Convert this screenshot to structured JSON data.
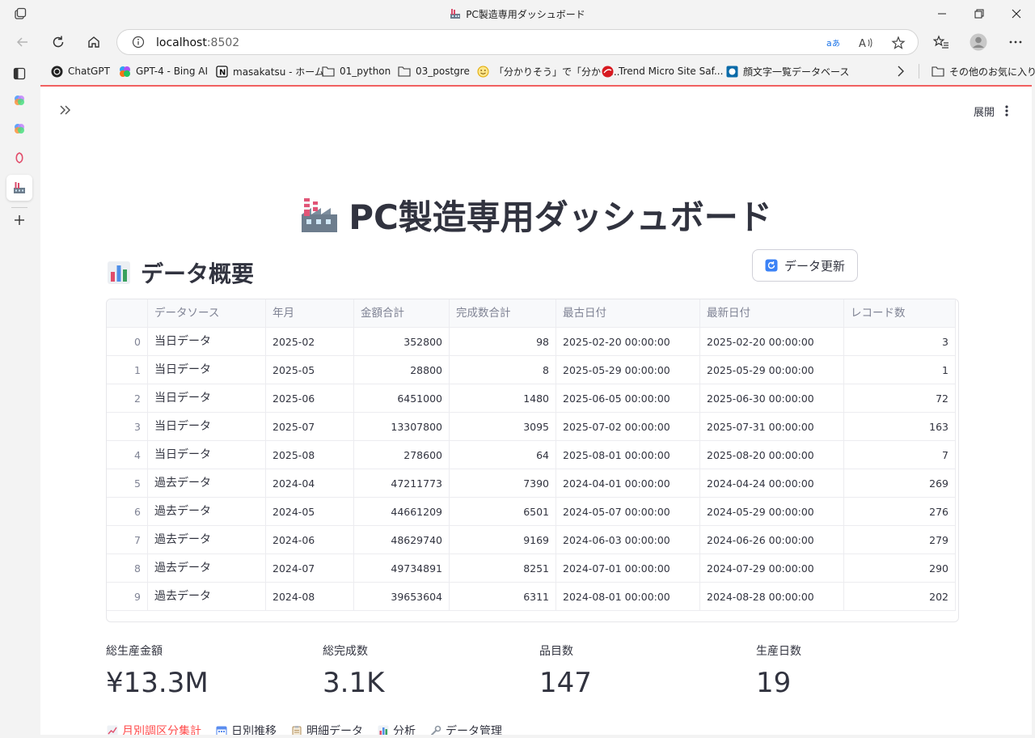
{
  "window": {
    "title": "PC製造専用ダッシュボード"
  },
  "address_bar": {
    "url_host": "localhost",
    "url_port": ":8502"
  },
  "bookmarks": [
    {
      "label": "ChatGPT",
      "icon": "openai-icon"
    },
    {
      "label": "GPT-4 - Bing AI",
      "icon": "copilot-icon"
    },
    {
      "label": "masakatsu - ホーム",
      "icon": "notion-icon"
    },
    {
      "label": "01_python",
      "icon": "folder-icon"
    },
    {
      "label": "03_postgre",
      "icon": "folder-icon"
    },
    {
      "label": "「分かりそう」で「分から...",
      "icon": "smile-icon"
    },
    {
      "label": "Trend Micro Site Saf...",
      "icon": "trendmicro-icon"
    },
    {
      "label": "顔文字一覧データベース",
      "icon": "site-icon"
    }
  ],
  "other_favorites": "その他のお気に入り",
  "app": {
    "deploy_label": "展開",
    "page_title": "PC製造専用ダッシュボード",
    "section_title": "データ概要",
    "refresh_button": "データ更新"
  },
  "table": {
    "columns": [
      "",
      "データソース",
      "年月",
      "金額合計",
      "完成数合計",
      "最古日付",
      "最新日付",
      "レコード数"
    ],
    "rows": [
      [
        "0",
        "当日データ",
        "2025-02",
        "352800",
        "98",
        "2025-02-20 00:00:00",
        "2025-02-20 00:00:00",
        "3"
      ],
      [
        "1",
        "当日データ",
        "2025-05",
        "28800",
        "8",
        "2025-05-29 00:00:00",
        "2025-05-29 00:00:00",
        "1"
      ],
      [
        "2",
        "当日データ",
        "2025-06",
        "6451000",
        "1480",
        "2025-06-05 00:00:00",
        "2025-06-30 00:00:00",
        "72"
      ],
      [
        "3",
        "当日データ",
        "2025-07",
        "13307800",
        "3095",
        "2025-07-02 00:00:00",
        "2025-07-31 00:00:00",
        "163"
      ],
      [
        "4",
        "当日データ",
        "2025-08",
        "278600",
        "64",
        "2025-08-01 00:00:00",
        "2025-08-20 00:00:00",
        "7"
      ],
      [
        "5",
        "過去データ",
        "2024-04",
        "47211773",
        "7390",
        "2024-04-01 00:00:00",
        "2024-04-24 00:00:00",
        "269"
      ],
      [
        "6",
        "過去データ",
        "2024-05",
        "44661209",
        "6501",
        "2024-05-07 00:00:00",
        "2024-05-29 00:00:00",
        "276"
      ],
      [
        "7",
        "過去データ",
        "2024-06",
        "48629740",
        "9169",
        "2024-06-03 00:00:00",
        "2024-06-26 00:00:00",
        "279"
      ],
      [
        "8",
        "過去データ",
        "2024-07",
        "49734891",
        "8251",
        "2024-07-01 00:00:00",
        "2024-07-29 00:00:00",
        "290"
      ],
      [
        "9",
        "過去データ",
        "2024-08",
        "39653604",
        "6311",
        "2024-08-01 00:00:00",
        "2024-08-28 00:00:00",
        "202"
      ]
    ]
  },
  "metrics": [
    {
      "label": "総生産金額",
      "value": "¥13.3M"
    },
    {
      "label": "総完成数",
      "value": "3.1K"
    },
    {
      "label": "品目数",
      "value": "147"
    },
    {
      "label": "生産日数",
      "value": "19"
    }
  ],
  "tabs": [
    {
      "label": "月別調区分集計",
      "icon": "chart-up-icon",
      "active": true
    },
    {
      "label": "日別推移",
      "icon": "calendar-icon",
      "active": false
    },
    {
      "label": "明細データ",
      "icon": "clipboard-icon",
      "active": false
    },
    {
      "label": "分析",
      "icon": "bar-chart-icon",
      "active": false
    },
    {
      "label": "データ管理",
      "icon": "wrench-icon",
      "active": false
    }
  ],
  "colors": {
    "accent": "#ff4b4b",
    "text": "#31333f",
    "muted": "#808495"
  }
}
